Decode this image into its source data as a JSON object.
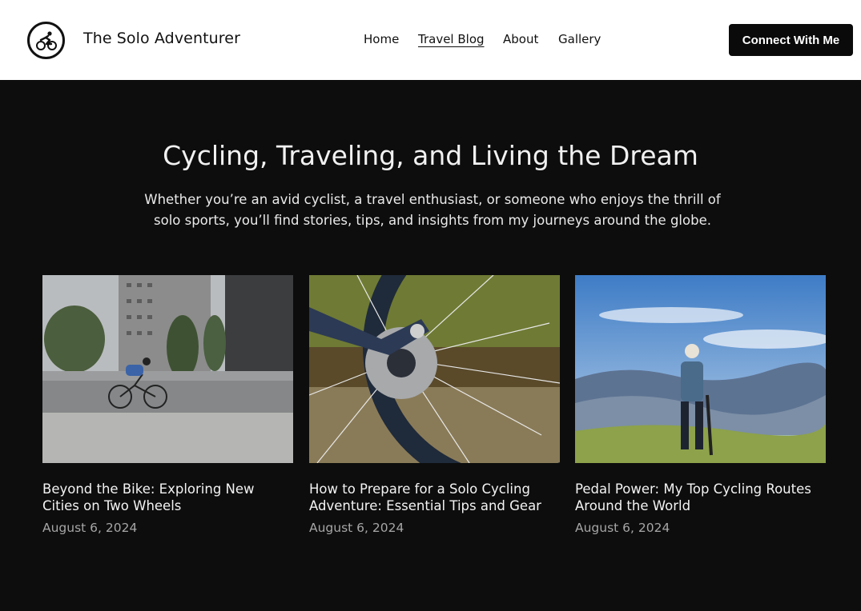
{
  "header": {
    "site_title": "The Solo Adventurer",
    "logo_icon": "cyclist-icon",
    "nav": [
      {
        "label": "Home"
      },
      {
        "label": "Travel Blog",
        "active": true
      },
      {
        "label": "About"
      },
      {
        "label": "Gallery"
      }
    ],
    "cta_label": "Connect With Me"
  },
  "hero": {
    "title": "Cycling, Traveling, and Living the Dream",
    "subtitle": "Whether you’re an avid cyclist, a travel enthusiast, or someone who enjoys the thrill of solo sports, you’ll find stories, tips, and insights from my journeys around the globe."
  },
  "posts": [
    {
      "title": "Beyond the Bike: Exploring New Cities on Two Wheels",
      "date": "August 6, 2024",
      "image": "city-cyclist-photo"
    },
    {
      "title": "How to Prepare for a Solo Cycling Adventure: Essential Tips and Gear",
      "date": "August 6, 2024",
      "image": "bike-wheel-closeup-photo"
    },
    {
      "title": "Pedal Power: My Top Cycling Routes Around the World",
      "date": "August 6, 2024",
      "image": "mountain-cyclist-photo"
    }
  ],
  "colors": {
    "background": "#0d0d0d",
    "header": "#ffffff",
    "cta": "#0a0a0a"
  }
}
